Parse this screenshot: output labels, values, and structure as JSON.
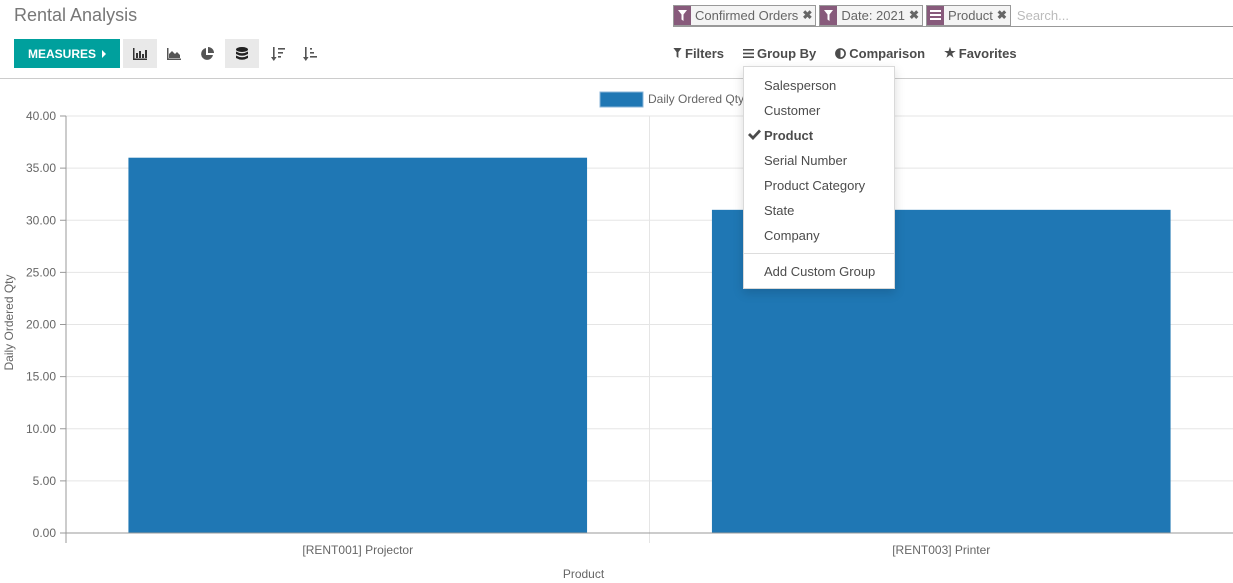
{
  "header": {
    "title": "Rental Analysis"
  },
  "toolbar": {
    "measures_label": "MEASURES",
    "buttons": [
      {
        "icon": "bar-chart-icon",
        "active": true
      },
      {
        "icon": "line-chart-icon",
        "active": false
      },
      {
        "icon": "pie-chart-icon",
        "active": false
      },
      {
        "icon": "stacked-icon",
        "active": true
      },
      {
        "icon": "sort-descending-icon",
        "active": false
      },
      {
        "icon": "sort-ascending-icon",
        "active": false
      }
    ]
  },
  "search": {
    "facets": [
      {
        "icon": "filter-icon",
        "value": "Confirmed Orders"
      },
      {
        "icon": "filter-icon",
        "value": "Date: 2021"
      },
      {
        "icon": "group-by-icon",
        "value": "Product"
      }
    ],
    "placeholder": "Search..."
  },
  "search_options": {
    "filters": "Filters",
    "group_by": "Group By",
    "comparison": "Comparison",
    "favorites": "Favorites"
  },
  "group_by_menu": {
    "items": [
      {
        "label": "Salesperson",
        "selected": false
      },
      {
        "label": "Customer",
        "selected": false
      },
      {
        "label": "Product",
        "selected": true
      },
      {
        "label": "Serial Number",
        "selected": false
      },
      {
        "label": "Product Category",
        "selected": false
      },
      {
        "label": "State",
        "selected": false
      },
      {
        "label": "Company",
        "selected": false
      }
    ],
    "add_custom_group": "Add Custom Group"
  },
  "colors": {
    "accent": "#00a09d",
    "facet": "#875a7b",
    "bar": "#1f77b4"
  },
  "chart_data": {
    "type": "bar",
    "title": "",
    "xlabel": "Product",
    "ylabel": "Daily Ordered Qty",
    "categories": [
      "[RENT001] Projector",
      "[RENT003] Printer"
    ],
    "series": [
      {
        "name": "Daily Ordered Qty",
        "values": [
          36,
          31
        ],
        "color": "#1f77b4"
      }
    ],
    "ylim": [
      0,
      40
    ],
    "yticks": [
      "0.00",
      "5.00",
      "10.00",
      "15.00",
      "20.00",
      "25.00",
      "30.00",
      "35.00",
      "40.00"
    ],
    "grid": true,
    "legend": "top-center"
  }
}
